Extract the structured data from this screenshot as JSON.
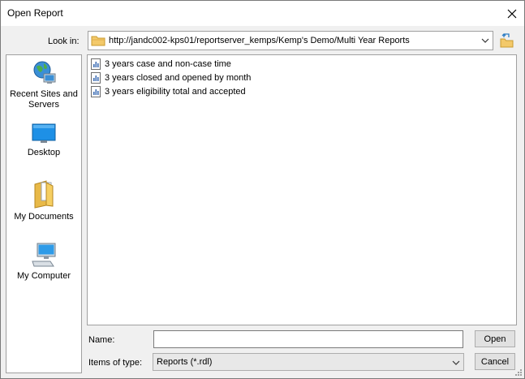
{
  "window": {
    "title": "Open Report"
  },
  "lookin": {
    "label": "Look in:",
    "path": "http://jandc002-kps01/reportserver_kemps/Kemp's Demo/Multi Year Reports"
  },
  "places": [
    {
      "label": "Recent Sites and Servers",
      "icon": "globe-computer-icon"
    },
    {
      "label": "Desktop",
      "icon": "desktop-icon"
    },
    {
      "label": "My Documents",
      "icon": "documents-folder-icon"
    },
    {
      "label": "My Computer",
      "icon": "computer-icon"
    }
  ],
  "files": [
    {
      "name": "3 years case and non-case time",
      "icon": "report-file-icon"
    },
    {
      "name": "3 years closed and opened by month",
      "icon": "report-file-icon"
    },
    {
      "name": "3 years eligibility total and accepted",
      "icon": "report-file-icon"
    }
  ],
  "name_field": {
    "label": "Name:",
    "value": ""
  },
  "type_field": {
    "label": "Items of type:",
    "value": "Reports (*.rdl)"
  },
  "buttons": {
    "open": "Open",
    "cancel": "Cancel"
  }
}
